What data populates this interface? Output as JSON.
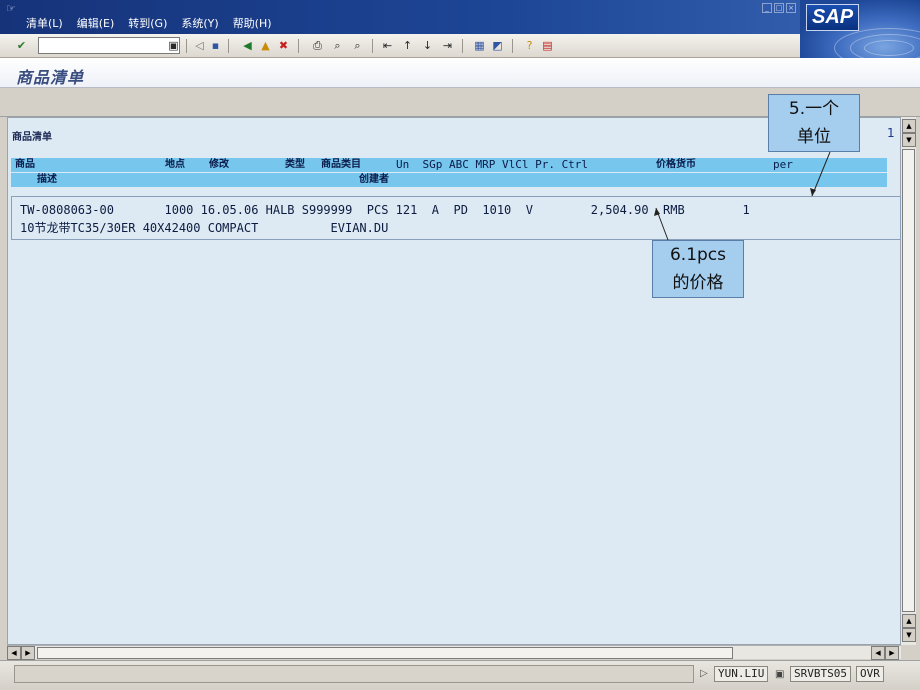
{
  "menu": {
    "items": [
      "清单(L)",
      "编辑(E)",
      "转到(G)",
      "系统(Y)",
      "帮助(H)"
    ],
    "logo": "SAP"
  },
  "toolbar": {
    "command_value": "",
    "icons": [
      "enter-icon",
      "save-icon",
      "back-icon",
      "exit-icon",
      "cancel-icon",
      "print-icon",
      "find-icon",
      "find-next-icon",
      "first-page-icon",
      "prev-page-icon",
      "next-page-icon",
      "last-page-icon",
      "new-session-icon",
      "shortcut-icon",
      "help-icon",
      "layout-icon"
    ]
  },
  "screen": {
    "title": "商品清单"
  },
  "list": {
    "title": "商品清单",
    "page": "1",
    "header1": {
      "material": "商品",
      "plant": "地点",
      "changed": "修改",
      "type": "类型",
      "group": "商品类目",
      "rest": "Un  SGp ABC MRP VlCl Pr. Ctrl",
      "price_currency": "价格货币",
      "per": "per"
    },
    "header2": {
      "description": "描述",
      "created_by": "创建者"
    },
    "row1": "TW-0808063-00       1000 16.05.06 HALB S999999  PCS 121  A  PD  1010  V        2,504.90  RMB        1",
    "row2": "10节龙带TC35/30ER 40X42400 COMPACT          EVIAN.DU"
  },
  "status": {
    "user": "YUN.LIU",
    "server": "SRVBTS05",
    "mode": "OVR"
  },
  "callouts": {
    "unit": [
      "5.一个",
      "单位"
    ],
    "price": [
      "6.1pcs",
      "的价格"
    ]
  },
  "colors": {
    "title_bar": "#1d4696",
    "list_header": "#76c6ee",
    "list_background": "#dde9f3",
    "callout": "#a5cdee"
  }
}
